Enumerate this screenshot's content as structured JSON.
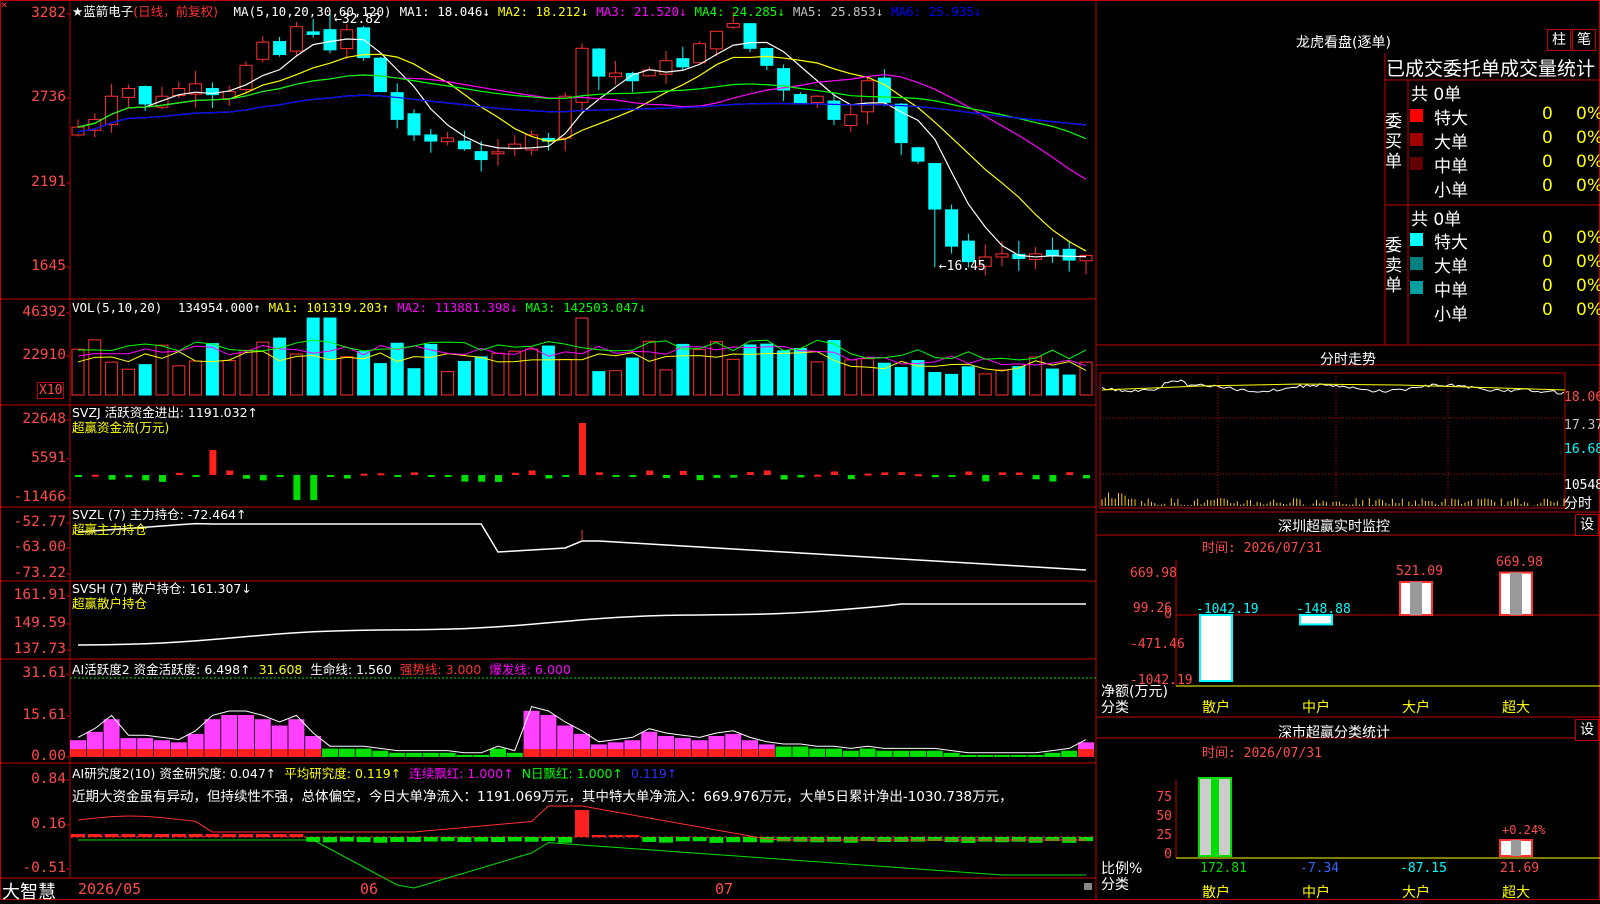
{
  "main": {
    "stock_title": "★蓝箭电子",
    "period": "(日线，前复权)",
    "ma_labels": [
      {
        "text": "MA(5,10,20,30,60,120)",
        "color": "#ffffff"
      },
      {
        "text": "MA1: 18.046↓",
        "color": "#ffffff"
      },
      {
        "text": "MA2: 18.212↓",
        "color": "#ffff00"
      },
      {
        "text": "MA3: 21.520↓",
        "color": "#ff00ff"
      },
      {
        "text": "MA4: 24.285↓",
        "color": "#00ff00"
      },
      {
        "text": "MA5: 25.853↓",
        "color": "#c0c0c0"
      },
      {
        "text": "MA6: 25.935↓",
        "color": "#0000ff"
      }
    ],
    "y_ticks": [
      "3282",
      "2736",
      "2191",
      "1645"
    ],
    "high_label": "←32.82",
    "low_label": "←16.45"
  },
  "vol": {
    "title": "VOL(5,10,20)",
    "values": [
      {
        "text": "134954.000↑",
        "color": "#ffffff"
      },
      {
        "text": "MA1: 101319.203↑",
        "color": "#ffff00"
      },
      {
        "text": "MA2: 113881.398↓",
        "color": "#ff00ff"
      },
      {
        "text": "MA3: 142503.047↓",
        "color": "#00ff00"
      }
    ],
    "y_ticks": [
      "46392",
      "22910"
    ],
    "unit": "X10"
  },
  "svzj": {
    "title": "SVZJ  活跃资金进出: 1191.032↑",
    "subtitle": "超赢资金流(万元)",
    "y_ticks": [
      "22648",
      "5591",
      "-11466"
    ]
  },
  "svzl": {
    "title": "SVZL (7) 主力持仓: -72.464↑",
    "subtitle": "超赢主力持仓",
    "y_ticks": [
      "-52.77",
      "-63.00",
      "-73.22"
    ]
  },
  "svsh": {
    "title": "SVSH (7) 散户持仓: 161.307↓",
    "subtitle": "超赢散户持仓",
    "y_ticks": [
      "161.91",
      "149.59",
      "137.73"
    ]
  },
  "ai1": {
    "parts": [
      {
        "text": "AI活跃度2 资金活跃度: 6.498↑",
        "color": "#ffffff"
      },
      {
        "text": "31.608",
        "color": "#ffff00"
      },
      {
        "text": "生命线: 1.560",
        "color": "#ffffff"
      },
      {
        "text": "强势线: 3.000",
        "color": "#ff3030"
      },
      {
        "text": "爆发线: 6.000",
        "color": "#ff00ff"
      }
    ],
    "y_ticks": [
      "31.61",
      "15.61",
      "0.00"
    ]
  },
  "ai2": {
    "parts": [
      {
        "text": "AI研究度2(10) 资金研究度: 0.047↑",
        "color": "#ffffff"
      },
      {
        "text": "平均研究度: 0.119↑",
        "color": "#ffff00"
      },
      {
        "text": "连续飘红: 1.000↑",
        "color": "#ff00ff"
      },
      {
        "text": "N日飘红: 1.000↑",
        "color": "#00ff00"
      },
      {
        "text": "0.119↑",
        "color": "#3030ff"
      }
    ],
    "comment": "近期大资金虽有异动，但持续性不强，总体偏空，今日大单净流入：1191.069万元，其中特大单净流入：669.976万元，大单5日累计净出-1030.738万元，",
    "y_ticks": [
      "0.84",
      "0.16",
      "-0.51"
    ]
  },
  "bottom": {
    "brand": "大智慧",
    "dates": [
      "2026/05",
      "06",
      "07"
    ]
  },
  "sidebar": {
    "lhb_title": "龙虎看盘(逐单)",
    "btn_bar": "柱",
    "btn_stroke": "笔",
    "stats_header": "已成交委托单成交量统计",
    "buy_label": "委买单",
    "sell_label": "委卖单",
    "buy_total": "共 0单",
    "sell_total": "共 0单",
    "buy_rows": [
      {
        "label": "特大",
        "count": "0",
        "pct": "0%",
        "color": "#ff0000"
      },
      {
        "label": "大单",
        "count": "0",
        "pct": "0%",
        "color": "#a00000"
      },
      {
        "label": "中单",
        "count": "0",
        "pct": "0%",
        "color": "#600000"
      },
      {
        "label": "小单",
        "count": "0",
        "pct": "0%",
        "color": ""
      }
    ],
    "sell_rows": [
      {
        "label": "特大",
        "count": "0",
        "pct": "0%",
        "color": "#00ffff"
      },
      {
        "label": "大单",
        "count": "0",
        "pct": "0%",
        "color": "#008080"
      },
      {
        "label": "中单",
        "count": "0",
        "pct": "0%",
        "color": "#00a0a0"
      },
      {
        "label": "小单",
        "count": "0",
        "pct": "0%",
        "color": ""
      }
    ],
    "intraday": {
      "title": "分时走势",
      "prices": [
        "18.06",
        "17.37",
        "16.68"
      ],
      "volume": "10548",
      "footer": "分时"
    },
    "monitor": {
      "title": "深圳超赢实时监控",
      "settings": "设",
      "time": "时间: 2026/07/31",
      "y_ticks": [
        "669.98",
        "99.26",
        "0",
        "-471.46",
        "-1042.19"
      ],
      "ylabel": "净额(万元)",
      "xlabel": "分类",
      "categories": [
        "散户",
        "中户",
        "大户",
        "超大"
      ],
      "values": [
        -1042.19,
        -148.88,
        521.09,
        669.98
      ],
      "labels": [
        "-1042.19",
        "-148.88",
        "521.09",
        "669.98"
      ]
    },
    "classify": {
      "title": "深市超赢分类统计",
      "settings": "设",
      "time": "时间: 2026/07/31",
      "y_ticks": [
        "75",
        "50",
        "25",
        "0"
      ],
      "ylabel": "比例%",
      "xlabel": "分类",
      "categories": [
        "散户",
        "中户",
        "大户",
        "超大"
      ],
      "values": [
        "172.81",
        "-7.34",
        "-87.15",
        "21.69"
      ],
      "annotation": "+0.24%"
    }
  }
}
